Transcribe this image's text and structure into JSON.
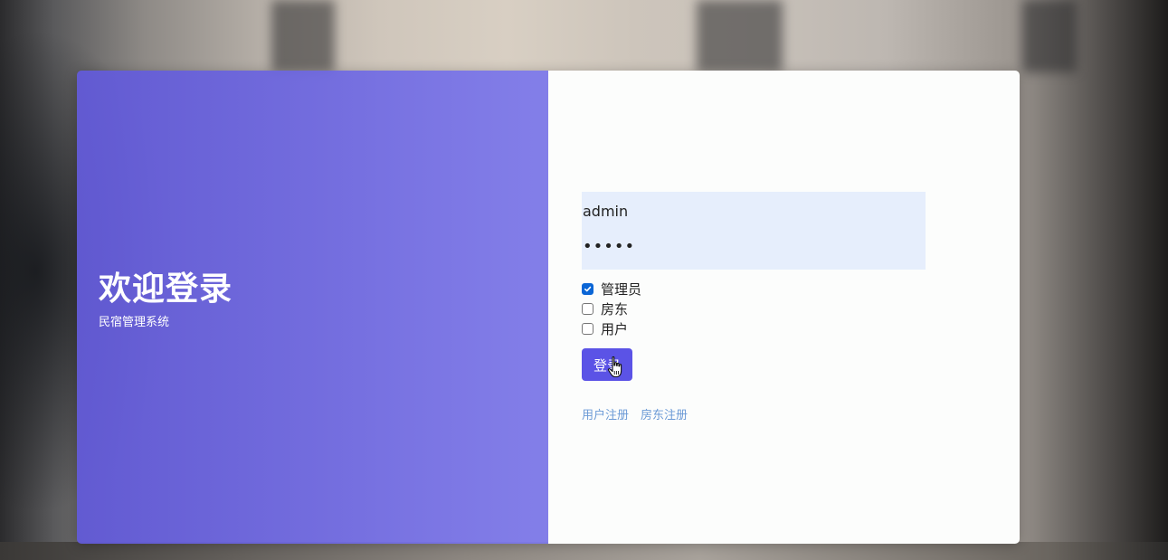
{
  "brand": {
    "title": "欢迎登录",
    "subtitle": "民宿管理系统"
  },
  "form": {
    "username_value": "admin",
    "password_value": "•••••",
    "roles": [
      {
        "label": "管理员",
        "checked": true
      },
      {
        "label": "房东",
        "checked": false
      },
      {
        "label": "用户",
        "checked": false
      }
    ],
    "login_label": "登录",
    "links": {
      "user_register": "用户注册",
      "landlord_register": "房东注册"
    }
  },
  "colors": {
    "brand_panel": "#6e68e2",
    "login_button": "#5b53e6",
    "checkbox_checked": "#0b66d6",
    "credential_box": "#e6eefc",
    "link": "#6b9ad6"
  }
}
